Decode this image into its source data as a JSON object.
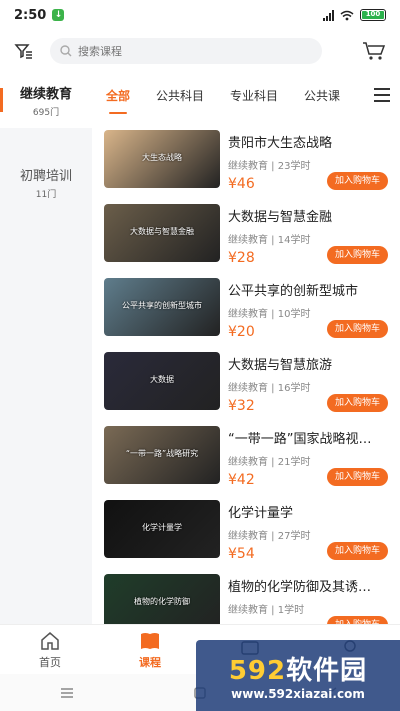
{
  "status": {
    "time": "2:50",
    "battery": "100"
  },
  "search": {
    "placeholder": "搜索课程"
  },
  "sidebar": {
    "items": [
      {
        "name": "继续教育",
        "count": "695门"
      },
      {
        "name": "初聘培训",
        "count": "11门"
      }
    ]
  },
  "tabs": [
    "全部",
    "公共科目",
    "专业科目",
    "公共课"
  ],
  "courses": [
    {
      "title": "贵阳市大生态战略",
      "meta": "继续教育 | 23学时",
      "price": "¥46",
      "thumb_text": "大生态战略",
      "thumb_color": "#d9b58a"
    },
    {
      "title": "大数据与智慧金融",
      "meta": "继续教育 | 14学时",
      "price": "¥28",
      "thumb_text": "大数据与智慧金融",
      "thumb_color": "#6b5e4a"
    },
    {
      "title": "公平共享的创新型城市",
      "meta": "继续教育 | 10学时",
      "price": "¥20",
      "thumb_text": "公平共享的创新型城市",
      "thumb_color": "#5f7d8c"
    },
    {
      "title": "大数据与智慧旅游",
      "meta": "继续教育 | 16学时",
      "price": "¥32",
      "thumb_text": "大数据",
      "thumb_color": "#2a2a3a"
    },
    {
      "title": "“一带一路”国家战略视…",
      "meta": "继续教育 | 21学时",
      "price": "¥42",
      "thumb_text": "“一带一路”战略研究",
      "thumb_color": "#7a6a55"
    },
    {
      "title": "化学计量学",
      "meta": "继续教育 | 27学时",
      "price": "¥54",
      "thumb_text": "化学计量学",
      "thumb_color": "#111111"
    },
    {
      "title": "植物的化学防御及其诱…",
      "meta": "继续教育 | 1学时",
      "price": "",
      "thumb_text": "植物的化学防御",
      "thumb_color": "#1f3d2a"
    }
  ],
  "add_cart_label": "加入购物车",
  "bottom_nav": [
    {
      "label": "首页",
      "icon": "home-icon"
    },
    {
      "label": "课程",
      "icon": "book-icon"
    },
    {
      "label": "",
      "icon": "message-icon"
    },
    {
      "label": "",
      "icon": "user-icon"
    }
  ],
  "watermark": {
    "big_num": "592",
    "big_text": "软件园",
    "url": "www.592xiazai.com"
  },
  "colors": {
    "accent": "#f36b21",
    "sidebar_bg": "#f5f6f8"
  }
}
